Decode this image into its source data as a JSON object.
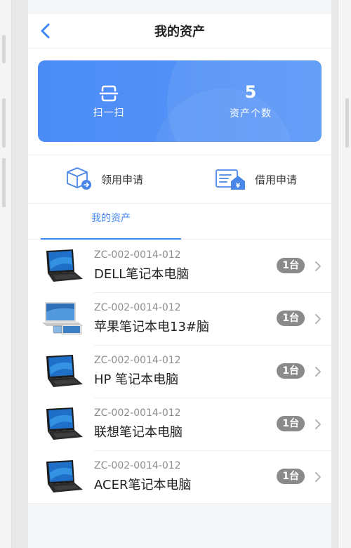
{
  "header": {
    "title": "我的资产"
  },
  "banner": {
    "scan_label": "扫一扫",
    "count_value": "5",
    "count_label": "资产个数"
  },
  "quick_actions": [
    {
      "label": "领用申请",
      "icon": "cube-receive-icon"
    },
    {
      "label": "借用申请",
      "icon": "document-borrow-icon"
    }
  ],
  "tabs": [
    {
      "label": "我的资产",
      "active": true
    }
  ],
  "assets": [
    {
      "code": "ZC-002-0014-012",
      "name": "DELL笔记本电脑",
      "qty": "1台",
      "thumb": "laptop"
    },
    {
      "code": "ZC-002-0014-012",
      "name": "苹果笔记本电13#脑",
      "qty": "1台",
      "thumb": "macbook"
    },
    {
      "code": "ZC-002-0014-012",
      "name": "HP 笔记本电脑",
      "qty": "1台",
      "thumb": "laptop"
    },
    {
      "code": "ZC-002-0014-012",
      "name": "联想笔记本电脑",
      "qty": "1台",
      "thumb": "laptop"
    },
    {
      "code": "ZC-002-0014-012",
      "name": "ACER笔记本电脑",
      "qty": "1台",
      "thumb": "laptop"
    }
  ],
  "colors": {
    "accent": "#3f86f3",
    "banner": "#4a8bf6",
    "badge": "#8a8a8a"
  }
}
